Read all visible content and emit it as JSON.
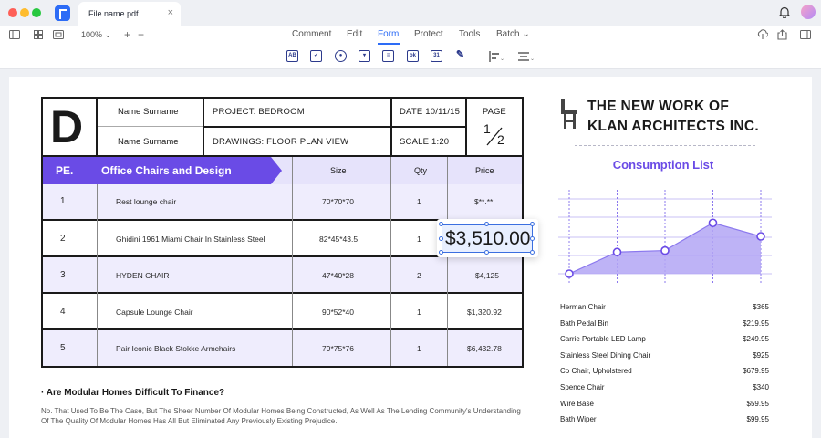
{
  "window": {
    "tab_title": "File name.pdf",
    "tab_close": "×"
  },
  "toolbar": {
    "zoom": "100%",
    "zoom_in": "+",
    "zoom_out": "−",
    "menu": [
      "Comment",
      "Edit",
      "Form",
      "Protect",
      "Tools",
      "Batch"
    ],
    "active_menu": "Form",
    "form_tools": [
      "text-field-tool",
      "checkbox-tool",
      "radio-button-tool",
      "combo-box-tool",
      "list-box-tool",
      "button-tool",
      "date-field-tool",
      "signature-tool"
    ],
    "form_tool_labels": [
      "AB",
      "✓",
      "●",
      "▾",
      "≡",
      "ok",
      "31",
      "✎"
    ]
  },
  "project": {
    "logo_letter": "D",
    "name_1": "Name Surname",
    "name_2": "Name Surname",
    "project": "PROJECT: BEDROOM",
    "drawings": "DRAWINGS: FLOOR PLAN VIEW",
    "date": "DATE 10/11/15",
    "scale": "SCALE 1:20",
    "page_label": "PAGE",
    "page_num": "1",
    "page_total": "2"
  },
  "table": {
    "col_pe": "PE.",
    "title": "Office Chairs and Design",
    "col_size": "Size",
    "col_qty": "Qty",
    "col_price": "Price",
    "rows": [
      {
        "num": "1",
        "name": "Rest lounge chair",
        "size": "70*70*70",
        "qty": "1",
        "price": "$**.**"
      },
      {
        "num": "2",
        "name": "Ghidini 1961 Miami Chair In Stainless Steel",
        "size": "82*45*43.5",
        "qty": "1",
        "price": ""
      },
      {
        "num": "3",
        "name": "HYDEN CHAIR",
        "size": "47*40*28",
        "qty": "2",
        "price": "$4,125"
      },
      {
        "num": "4",
        "name": "Capsule Lounge Chair",
        "size": "90*52*40",
        "qty": "1",
        "price": "$1,320.92"
      },
      {
        "num": "5",
        "name": "Pair Iconic Black Stokke Armchairs",
        "size": "79*75*76",
        "qty": "1",
        "price": "$6,432.78"
      }
    ]
  },
  "price_field": {
    "value": "$3,510.00"
  },
  "faq": {
    "question": "· Are Modular Homes Difficult To Finance?",
    "answer": "No. That Used To Be The Case, But The Sheer Number Of Modular Homes Being Constructed, As Well As The Lending Community's Understanding Of The Quality Of Modular Homes Has All But Eliminated Any Previously Existing Prejudice."
  },
  "company": {
    "line1": "THE NEW WORK OF",
    "line2": "KLAN ARCHITECTS INC."
  },
  "consumption": {
    "title": "Consumption List",
    "items": [
      {
        "name": "Herman Chair",
        "price": "$365"
      },
      {
        "name": "Bath Pedal Bin",
        "price": "$219.95"
      },
      {
        "name": "Carrie Portable LED Lamp",
        "price": "$249.95"
      },
      {
        "name": "Stainless Steel Dining Chair",
        "price": "$925"
      },
      {
        "name": "Co Chair, Upholstered",
        "price": "$679.95"
      },
      {
        "name": "Spence Chair",
        "price": "$340"
      },
      {
        "name": "Wire Base",
        "price": "$59.95"
      },
      {
        "name": "Bath Wiper",
        "price": "$99.95"
      }
    ]
  },
  "chart_data": {
    "type": "area",
    "values": [
      0.0,
      0.29,
      0.31,
      0.68,
      0.5
    ],
    "ylim": [
      0,
      1
    ],
    "grid": true,
    "color": "#b3a6f5",
    "line_color": "#8b78ee"
  },
  "colors": {
    "accent": "#6a4be6",
    "brand": "#2d6cf6",
    "row_tint": "#efedfd"
  }
}
